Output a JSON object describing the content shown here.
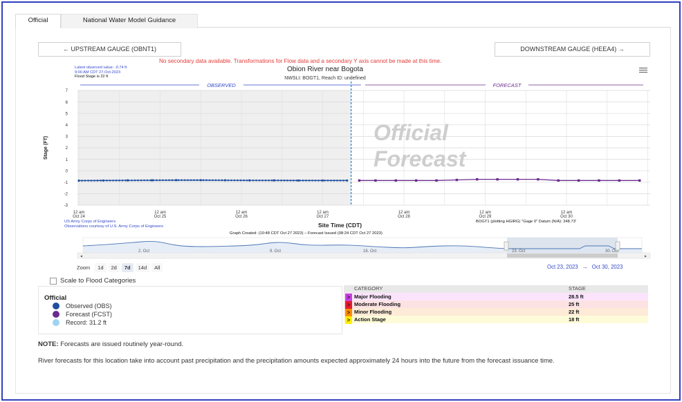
{
  "tabs": [
    {
      "label": "Official"
    },
    {
      "label": "National Water Model Guidance"
    }
  ],
  "nav": {
    "upstream_label": "←  UPSTREAM GAUGE (OBNT1)",
    "downstream_label": "DOWNSTREAM GAUGE (HEEA4)  →"
  },
  "warning": "No secondary data available. Transformations for Flow data and a secondary Y axis cannot be made at this time.",
  "latest": {
    "line1": "Latest observed value: -0.74 ft",
    "line2": "9:00 AM CDT 27-Oct-2023",
    "line3": "Flood Stage is 22 ft"
  },
  "chart_header": {
    "title": "Obion River near Bogota",
    "subtitle": "NWSLI: BOGT1, Reach ID: undefined"
  },
  "chart_data": {
    "type": "line",
    "title": "Obion River near Bogota",
    "ylabel": "Stage (FT)",
    "xlabel": "Site Time (CDT)",
    "ylim": [
      -3,
      7
    ],
    "yticks": [
      "7",
      "6",
      "5",
      "4",
      "3",
      "2",
      "1",
      "0",
      "-1",
      "-2",
      "-3"
    ],
    "xticks": [
      {
        "line1": "12 am",
        "line2": "Oct 24"
      },
      {
        "line1": "12 am",
        "line2": "Oct 25"
      },
      {
        "line1": "12 am",
        "line2": "Oct 26"
      },
      {
        "line1": "12 am",
        "line2": "Oct 27"
      },
      {
        "line1": "12 am",
        "line2": "Oct 28"
      },
      {
        "line1": "12 am",
        "line2": "Oct 29"
      },
      {
        "line1": "12 am",
        "line2": "Oct 30"
      }
    ],
    "observed_band_label": "OBSERVED",
    "forecast_band_label": "FORECAST",
    "watermark": [
      "Official",
      "Forecast"
    ],
    "forecast_issued_day": 3.35,
    "series": [
      {
        "name": "Observed (OBS)",
        "color": "#1f4fa0",
        "x_days": [
          0,
          0.3,
          0.6,
          0.9,
          1.2,
          1.5,
          1.8,
          2.1,
          2.4,
          2.7,
          3.0,
          3.3
        ],
        "values": [
          -0.86,
          -0.85,
          -0.84,
          -0.83,
          -0.82,
          -0.82,
          -0.83,
          -0.84,
          -0.84,
          -0.85,
          -0.85,
          -0.85
        ]
      },
      {
        "name": "Forecast (FCST)",
        "color": "#6a2c8e",
        "x_days": [
          3.45,
          3.65,
          3.9,
          4.15,
          4.4,
          4.65,
          4.9,
          5.15,
          5.4,
          5.65,
          5.9,
          6.15,
          6.4,
          6.65,
          6.9
        ],
        "values": [
          -0.85,
          -0.85,
          -0.85,
          -0.85,
          -0.85,
          -0.8,
          -0.75,
          -0.75,
          -0.75,
          -0.75,
          -0.85,
          -0.85,
          -0.85,
          -0.85,
          -0.85
        ]
      }
    ]
  },
  "sources": {
    "line1": "US Army Corps of Engineers",
    "line2": "Observations courtesy of U.S. Army Corps of Engineers"
  },
  "datum": "BOGT1 (plotting HGIRG) \"Gage 0\" Datum (N/A): 248.73'",
  "created": "Graph Created: (10:48 CDT Oct 27 2023) – Forecast Issued (08:24 CDT Oct 27 2023)",
  "navigator": {
    "labels": [
      "2. Oct",
      "9. Oct",
      "16. Oct",
      "23. Oct",
      "30. Oct"
    ]
  },
  "zoom": {
    "label": "Zoom",
    "options": [
      "1d",
      "2d",
      "7d",
      "14d",
      "All"
    ],
    "selected": "7d"
  },
  "range": {
    "from": "Oct 23, 2023",
    "sep": "→",
    "to": "Oct 30, 2023"
  },
  "scale_label": "Scale to Flood Categories",
  "legend": {
    "title": "Official",
    "items": [
      {
        "label": "Observed (OBS)",
        "color": "#1f4fa0"
      },
      {
        "label": "Forecast (FCST)",
        "color": "#6a2c8e"
      },
      {
        "label": "Record: 31.2 ft",
        "color": "#9dd3f0"
      }
    ]
  },
  "categories": {
    "col1": "CATEGORY",
    "col2": "STAGE",
    "rows": [
      {
        "name": "Major Flooding",
        "stage": "28.5 ft",
        "color": "#c640e0",
        "bg": "#fbe4fb"
      },
      {
        "name": "Moderate Flooding",
        "stage": "25 ft",
        "color": "#e8192c",
        "bg": "#fde2e4"
      },
      {
        "name": "Minor Flooding",
        "stage": "22 ft",
        "color": "#ff8c00",
        "bg": "#fdebd7"
      },
      {
        "name": "Action Stage",
        "stage": "18 ft",
        "color": "#ffee00",
        "bg": "#fefbd8"
      }
    ]
  },
  "note": {
    "bold": "NOTE:",
    "text": " Forecasts are issued routinely year-round."
  },
  "paragraph": "River forecasts for this location take into account past precipitation and the precipitation amounts expected approximately 24 hours into the future from the forecast issuance time."
}
